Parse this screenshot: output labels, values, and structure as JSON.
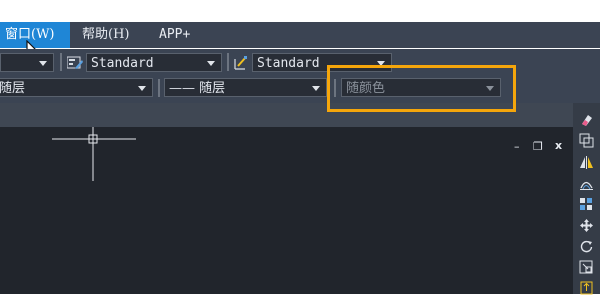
{
  "menu": {
    "items": [
      {
        "label": "窗口(W)",
        "active": true
      },
      {
        "label": "帮助(H)",
        "active": false
      },
      {
        "label": "APP+",
        "active": false
      }
    ]
  },
  "toolbar1": {
    "text_style": "Standard",
    "dim_style": "Standard"
  },
  "toolbar2": {
    "layer": "随层",
    "linetype": "—— 随层",
    "color": "随颜色"
  },
  "window_controls": {
    "minimize": "–",
    "restore": "❐",
    "close": "x"
  },
  "colors": {
    "menu_bg": "#3b4453",
    "active_menu": "#1f86d6",
    "canvas_bg": "#21252c",
    "highlight": "#f5a60b"
  }
}
